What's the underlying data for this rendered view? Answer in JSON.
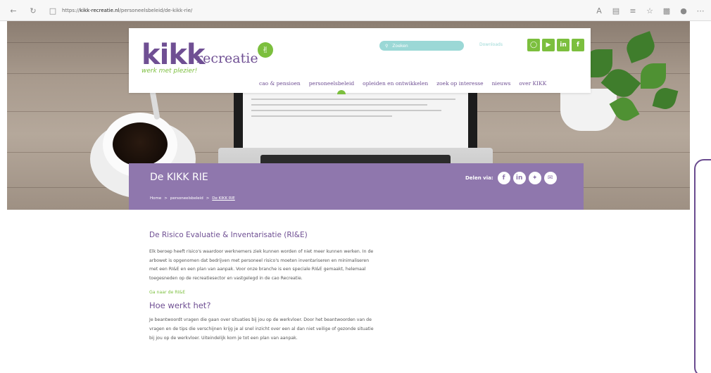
{
  "browser": {
    "url_prefix": "https://",
    "url_host": "kikk-recreatie.nl",
    "url_path": "/personeelsbeleid/de-kikk-rie/"
  },
  "header": {
    "logo_main": "kikk",
    "logo_sub": "recreatie",
    "logo_tagline": "werk met plezier!",
    "search_placeholder": "Zoeken",
    "downloads": "Downloads",
    "social": [
      "instagram-icon",
      "youtube-icon",
      "linkedin-icon",
      "facebook-icon"
    ],
    "nav": [
      "cao & pensioen",
      "personeelsbeleid",
      "opleiden en ontwikkelen",
      "zoek op interesse",
      "nieuws",
      "over KIKK"
    ],
    "active_nav_index": 1
  },
  "title_band": {
    "title": "De KIKK RIE",
    "share_label": "Delen via:",
    "share_icons": [
      "facebook-icon",
      "linkedin-icon",
      "twitter-icon",
      "email-icon"
    ],
    "breadcrumb": [
      "Home",
      ">",
      "personeelsbeleid",
      ">",
      "De KIKK RIE"
    ]
  },
  "content": {
    "section_title": "De Risico Evaluatie & Inventarisatie (RI&E)",
    "para1": [
      "Elk beroep heeft risico's waardoor werknemers ziek kunnen worden of niet meer kunnen werken. In de",
      "arbowet is opgenomen dat bedrijven met personeel risico's moeten inventariseren en minimaliseren",
      "met een RI&E en een plan van aanpak. Voor onze branche is een speciale RI&E gemaakt, helemaal",
      "toegesneden op de recreatiesector en vastgelegd in de cao Recreatie."
    ],
    "link": "Ga naar de RI&E",
    "how_title": "Hoe werkt het?",
    "para2": [
      "Je beantwoordt vragen die gaan over situaties bij jou op de werkvloer. Door het beantwoorden van de",
      "vragen en de tips die verschijnen krijg je al snel inzicht over een al dan niet veilige of gezonde situatie",
      "bij jou op de werkvloer. Uiteindelijk kom je tot een plan van aanpak."
    ]
  },
  "colors": {
    "brand_purple": "#6f4f93",
    "band_purple": "#8f77ad",
    "brand_green": "#7cbf3e",
    "search_teal": "#9bd8d6"
  }
}
